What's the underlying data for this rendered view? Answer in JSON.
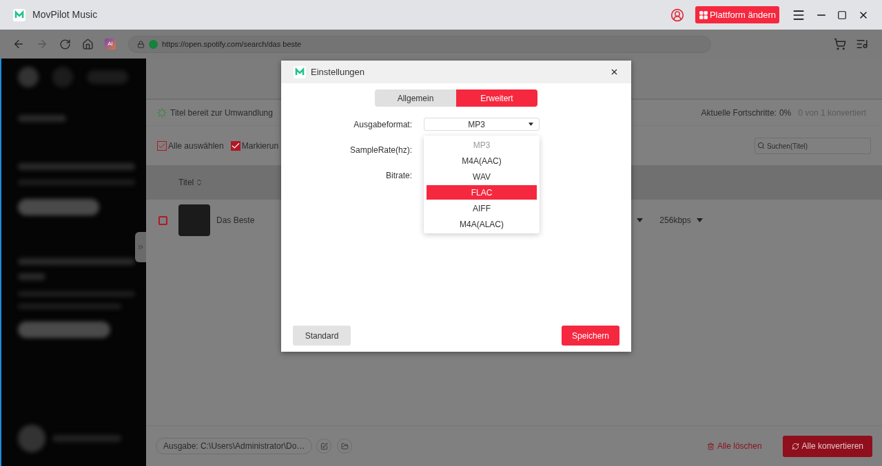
{
  "app": {
    "title": "MovPilot Music",
    "platform_button": "Plattform ändern"
  },
  "browser": {
    "ai_badge": "AI",
    "url": "https://open.spotify.com/search/das beste"
  },
  "status": {
    "ready": "Titel bereit zur Umwandlung",
    "progress_label": "Aktuelle Fortschritte:",
    "progress_value": "0%",
    "converted": "0 von 1 konvertiert"
  },
  "toolbar": {
    "select_all": "Alle auswählen",
    "mark": "Markierun",
    "search": {
      "placeholder": "Suchen(Titel)"
    }
  },
  "table": {
    "columns": [
      "Titel"
    ],
    "rows": [
      {
        "title": "Das Beste",
        "checked": false,
        "bitrate": "256kbps"
      }
    ]
  },
  "footer": {
    "output": "Ausgabe: C:\\Users\\Administrator\\Do…",
    "delete_all": "Alle löschen",
    "convert_all": "Alle konvertieren"
  },
  "dialog": {
    "title": "Einstellungen",
    "tabs": [
      {
        "label": "Allgemein",
        "selected": false
      },
      {
        "label": "Erweitert",
        "selected": true
      }
    ],
    "fields": [
      {
        "label": "Ausgabeformat:",
        "value": "MP3",
        "expanded": true
      },
      {
        "label": "SampleRate(hz):"
      },
      {
        "label": "Bitrate:"
      }
    ],
    "options": [
      {
        "label": "MP3",
        "current": true,
        "selected": false
      },
      {
        "label": "M4A(AAC)",
        "current": false,
        "selected": false
      },
      {
        "label": "WAV",
        "current": false,
        "selected": false
      },
      {
        "label": "FLAC",
        "current": false,
        "selected": true
      },
      {
        "label": "AIFF",
        "current": false,
        "selected": false
      },
      {
        "label": "M4A(ALAC)",
        "current": false,
        "selected": false
      }
    ],
    "buttons": {
      "reset": "Standard",
      "save": "Speichern"
    }
  }
}
